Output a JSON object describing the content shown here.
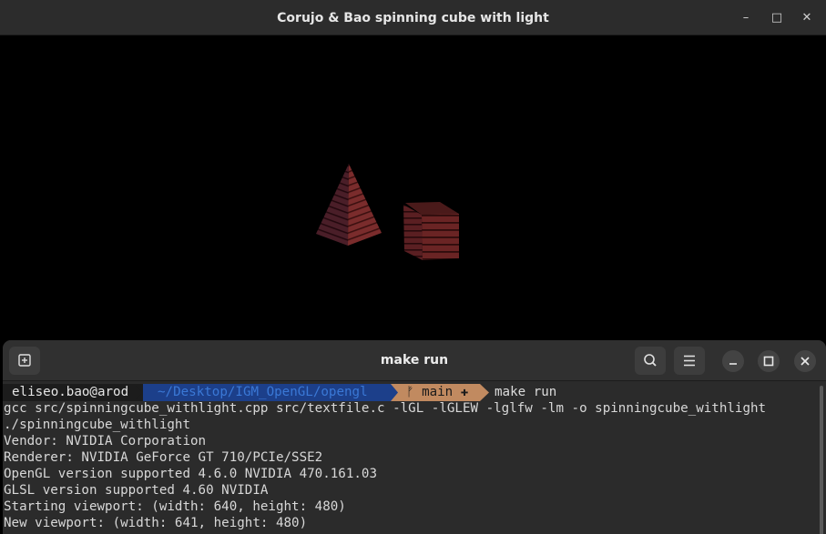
{
  "gl_window": {
    "title": "Corujo & Bao spinning cube with light",
    "controls": {
      "minimize": "–",
      "maximize": "□",
      "close": "✕"
    }
  },
  "terminal": {
    "title": "make run",
    "prompt": {
      "user": "eliseo.bao@arod",
      "path": "~/Desktop/IGM_OpenGL/opengl",
      "branch_icon": "ᚠ",
      "branch": "main",
      "status": "✚",
      "command": "make run"
    },
    "lines": [
      "gcc src/spinningcube_withlight.cpp src/textfile.c -lGL -lGLEW -lglfw -lm -o spinningcube_withlight",
      "./spinningcube_withlight",
      "Vendor: NVIDIA Corporation",
      "Renderer: NVIDIA GeForce GT 710/PCIe/SSE2",
      "OpenGL version supported 4.6.0 NVIDIA 470.161.03",
      "GLSL version supported 4.60 NVIDIA",
      "Starting viewport: (width: 640, height: 480)",
      "New viewport: (width: 641, height: 480)"
    ]
  },
  "colors": {
    "path_bg": "#1c3f8a",
    "git_bg": "#c18a60",
    "titlebar": "#2c2c2c",
    "terminal_bg": "#2b2b2b"
  },
  "icons": [
    "new-tab-icon",
    "search-icon",
    "hamburger-menu-icon",
    "minimize-icon",
    "maximize-icon",
    "close-icon",
    "git-branch-icon"
  ]
}
